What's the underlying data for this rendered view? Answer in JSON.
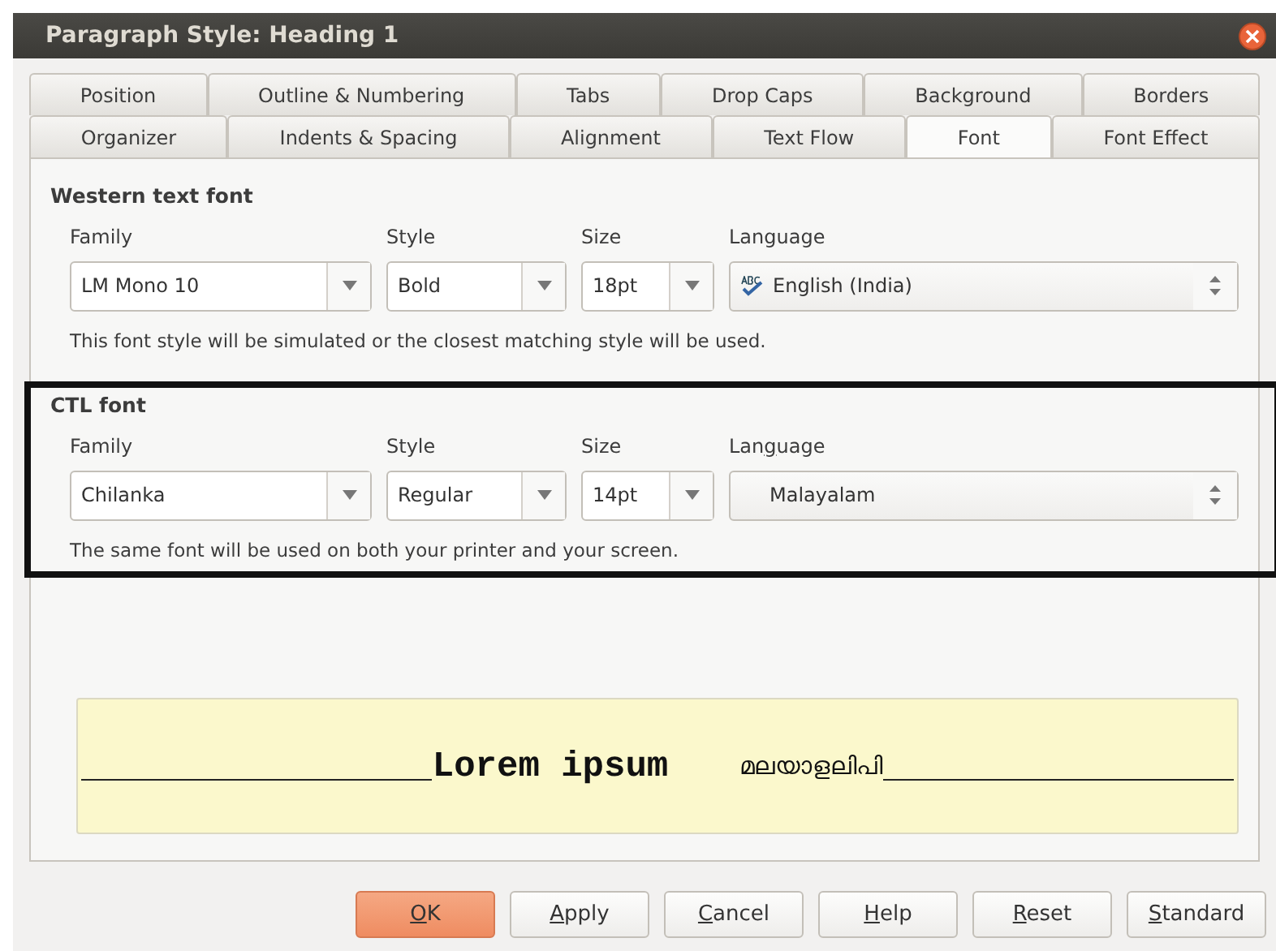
{
  "window": {
    "title": "Paragraph Style: Heading 1"
  },
  "tab_rows": [
    [
      {
        "label": "Position",
        "selected": false
      },
      {
        "label": "Outline & Numbering",
        "selected": false
      },
      {
        "label": "Tabs",
        "selected": false
      },
      {
        "label": "Drop Caps",
        "selected": false
      },
      {
        "label": "Background",
        "selected": false
      },
      {
        "label": "Borders",
        "selected": false
      }
    ],
    [
      {
        "label": "Organizer",
        "selected": false
      },
      {
        "label": "Indents & Spacing",
        "selected": false
      },
      {
        "label": "Alignment",
        "selected": false
      },
      {
        "label": "Text Flow",
        "selected": false
      },
      {
        "label": "Font",
        "selected": true
      },
      {
        "label": "Font Effect",
        "selected": false
      }
    ]
  ],
  "sections": [
    {
      "title": "Western text font",
      "highlighted": false,
      "family_label": "Family",
      "family": "LM Mono 10",
      "style_label": "Style",
      "style": "Bold",
      "size_label": "Size",
      "size": "18pt",
      "language_label": "Language",
      "language": "English (India)",
      "spellcheck": true,
      "note": "This font style will be simulated or the closest matching style will be used."
    },
    {
      "title": "CTL font",
      "highlighted": true,
      "family_label": "Family",
      "family": "Chilanka",
      "style_label": "Style",
      "style": "Regular",
      "size_label": "Size",
      "size": "14pt",
      "language_label": "Lan",
      "language_mnemonic": "g",
      "language_label_rest": "uage",
      "language": "Malayalam",
      "spellcheck": false,
      "note": "The same font will be used on both your printer and your screen."
    }
  ],
  "preview": {
    "western": "Lorem ipsum",
    "ctl": "മലയാളലിപി"
  },
  "buttons": [
    {
      "mnemonic": "O",
      "label_rest": "K",
      "default": true
    },
    {
      "mnemonic": "A",
      "label_rest": "pply",
      "default": false
    },
    {
      "mnemonic": "C",
      "label_rest": "ancel",
      "default": false
    },
    {
      "mnemonic": "H",
      "label_rest": "elp",
      "default": false
    },
    {
      "mnemonic": "R",
      "label_rest": "eset",
      "default": false
    },
    {
      "mnemonic": "S",
      "label_rest": "tandard",
      "default": false
    }
  ]
}
